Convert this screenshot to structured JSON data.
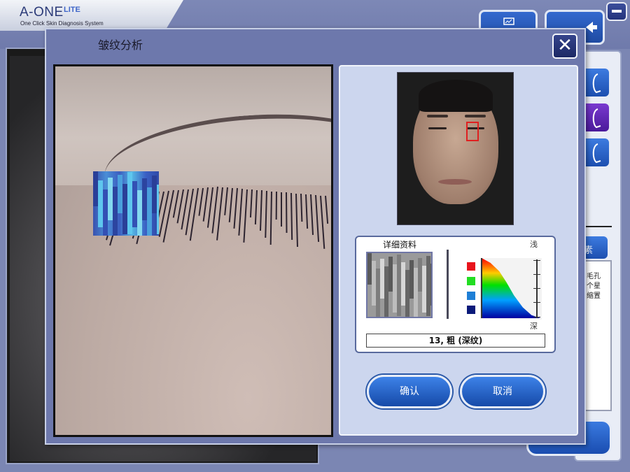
{
  "app": {
    "name": "A-ONE",
    "edition": "LITE",
    "tagline": "One Click Skin Diagnosis System"
  },
  "background": {
    "right_panel_partial_button": "素",
    "right_panel_text_lines": [
      "毛孔",
      "个星",
      "缩置"
    ]
  },
  "dialog": {
    "title": "皱纹分析",
    "close_label": "✕",
    "detail_label": "详细资料",
    "scale_top": "浅",
    "scale_bottom": "深",
    "result_value": "13, 粗 (深纹)",
    "confirm_label": "确认",
    "cancel_label": "取消",
    "legend_colors": [
      "#e8141c",
      "#22dd22",
      "#1e7fd6",
      "#0a1a7a"
    ]
  },
  "icons": {
    "minimize": "minimize-icon",
    "close": "close-icon",
    "monitor": "monitor-icon",
    "back": "back-arrow-icon",
    "face_profile": "face-profile-icon"
  }
}
